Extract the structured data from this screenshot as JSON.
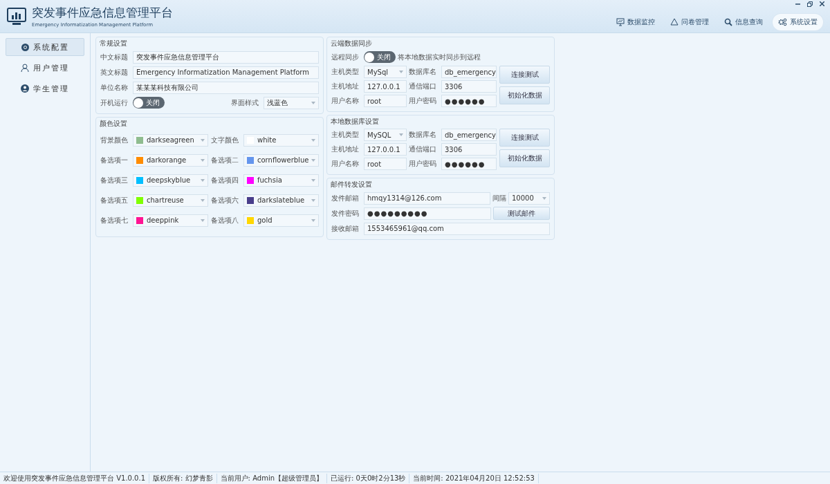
{
  "app": {
    "title": "突发事件应急信息管理平台",
    "subtitle": "Emergency Informatization Management Platform"
  },
  "nav": [
    {
      "label": "数据监控",
      "selected": false
    },
    {
      "label": "问卷管理",
      "selected": false
    },
    {
      "label": "信息查询",
      "selected": false
    },
    {
      "label": "系统设置",
      "selected": true
    }
  ],
  "sidebar": {
    "items": [
      {
        "label": "系统配置",
        "selected": true
      },
      {
        "label": "用户管理",
        "selected": false
      },
      {
        "label": "学生管理",
        "selected": false
      }
    ]
  },
  "general": {
    "title": "常规设置",
    "fields": [
      {
        "label": "中文标题",
        "value": "突发事件应急信息管理平台"
      },
      {
        "label": "英文标题",
        "value": "Emergency Informatization Management Platform"
      },
      {
        "label": "单位名称",
        "value": "某某某科技有限公司"
      }
    ],
    "autostart": {
      "label": "开机运行",
      "on": false,
      "text": "关闭"
    },
    "style": {
      "label": "界面样式",
      "value": "浅蓝色"
    }
  },
  "colors": {
    "title": "颜色设置",
    "items": [
      {
        "label": "背景颜色",
        "value": "darkseagreen",
        "color": "#8fbc8f"
      },
      {
        "label": "文字颜色",
        "value": "white",
        "color": "#ffffff"
      },
      {
        "label": "备选项一",
        "value": "darkorange",
        "color": "#ff8c00"
      },
      {
        "label": "备选项二",
        "value": "cornflowerblue",
        "color": "#6495ed"
      },
      {
        "label": "备选项三",
        "value": "deepskyblue",
        "color": "#00bfff"
      },
      {
        "label": "备选项四",
        "value": "fuchsia",
        "color": "#ff00ff"
      },
      {
        "label": "备选项五",
        "value": "chartreuse",
        "color": "#7fff00"
      },
      {
        "label": "备选项六",
        "value": "darkslateblue",
        "color": "#483d8b"
      },
      {
        "label": "备选项七",
        "value": "deeppink",
        "color": "#ff1493"
      },
      {
        "label": "备选项八",
        "value": "gold",
        "color": "#ffd700"
      }
    ]
  },
  "cloud": {
    "title": "云端数据同步",
    "sync": {
      "label": "远程同步",
      "on": false,
      "text": "关闭",
      "note": "将本地数据实时同步到远程"
    },
    "fields": [
      {
        "label": "主机类型",
        "value": "MySql",
        "kind": "select"
      },
      {
        "label": "数据库名",
        "value": "db_emergency",
        "kind": "text"
      },
      {
        "label": "主机地址",
        "value": "127.0.0.1",
        "kind": "text"
      },
      {
        "label": "通信端口",
        "value": "3306",
        "kind": "text"
      },
      {
        "label": "用户名称",
        "value": "root",
        "kind": "text"
      },
      {
        "label": "用户密码",
        "value": "●●●●●●",
        "kind": "password"
      }
    ],
    "buttons": [
      "连接测试",
      "初始化数据"
    ]
  },
  "local": {
    "title": "本地数据库设置",
    "fields": [
      {
        "label": "主机类型",
        "value": "MySQL",
        "kind": "select"
      },
      {
        "label": "数据库名",
        "value": "db_emergency",
        "kind": "text"
      },
      {
        "label": "主机地址",
        "value": "127.0.0.1",
        "kind": "text"
      },
      {
        "label": "通信端口",
        "value": "3306",
        "kind": "text"
      },
      {
        "label": "用户名称",
        "value": "root",
        "kind": "text"
      },
      {
        "label": "用户密码",
        "value": "●●●●●●",
        "kind": "password"
      }
    ],
    "buttons": [
      "连接测试",
      "初始化数据"
    ]
  },
  "mail": {
    "title": "邮件转发设置",
    "sender": {
      "label": "发件邮箱",
      "value": "hmqy1314@126.com"
    },
    "interval": {
      "label": "间隔",
      "value": "10000"
    },
    "password": {
      "label": "发件密码",
      "value": "●●●●●●●●●"
    },
    "test_button": "测试邮件",
    "receiver": {
      "label": "接收邮箱",
      "value": "1553465961@qq.com"
    }
  },
  "status_bar": [
    "欢迎使用突发事件应急信息管理平台 V1.0.0.1",
    "版权所有: 幻梦青影",
    "当前用户: Admin【超级管理员】",
    "已运行: 0天0时2分13秒",
    "当前时间: 2021年04月20日 12:52:53"
  ]
}
